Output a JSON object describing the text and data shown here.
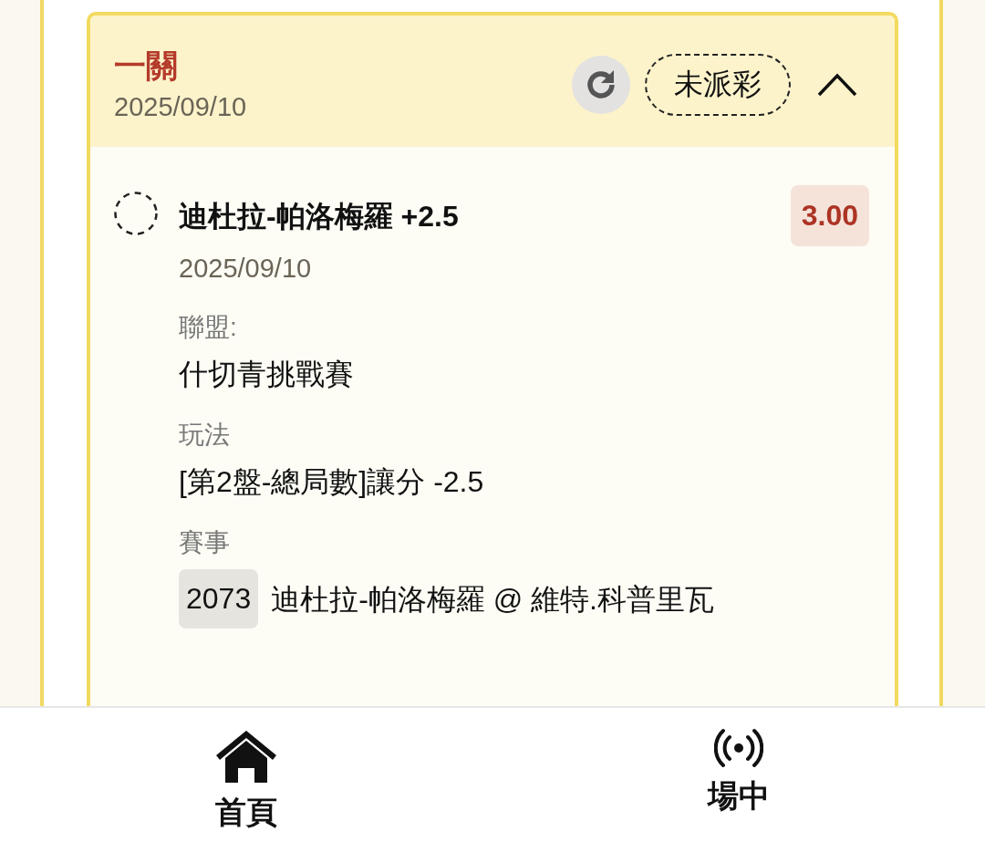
{
  "bet": {
    "title": "一關",
    "date": "2025/09/10",
    "status": "未派彩",
    "expanded": true,
    "selections": [
      {
        "name": "迪杜拉-帕洛梅羅 +2.5",
        "date": "2025/09/10",
        "odds": "3.00",
        "fields": [
          {
            "kind": "text",
            "label": "聯盟:",
            "value": "什切青挑戰賽"
          },
          {
            "kind": "text",
            "label": "玩法",
            "value": "[第2盤-總局數]讓分 -2.5"
          },
          {
            "kind": "match",
            "label": "賽事",
            "match_id": "2073",
            "value": "迪杜拉-帕洛梅羅 @ 維特.科普里瓦"
          }
        ]
      }
    ]
  },
  "nav": [
    {
      "kind": "home",
      "label": "首頁"
    },
    {
      "kind": "live",
      "label": "場中"
    }
  ]
}
